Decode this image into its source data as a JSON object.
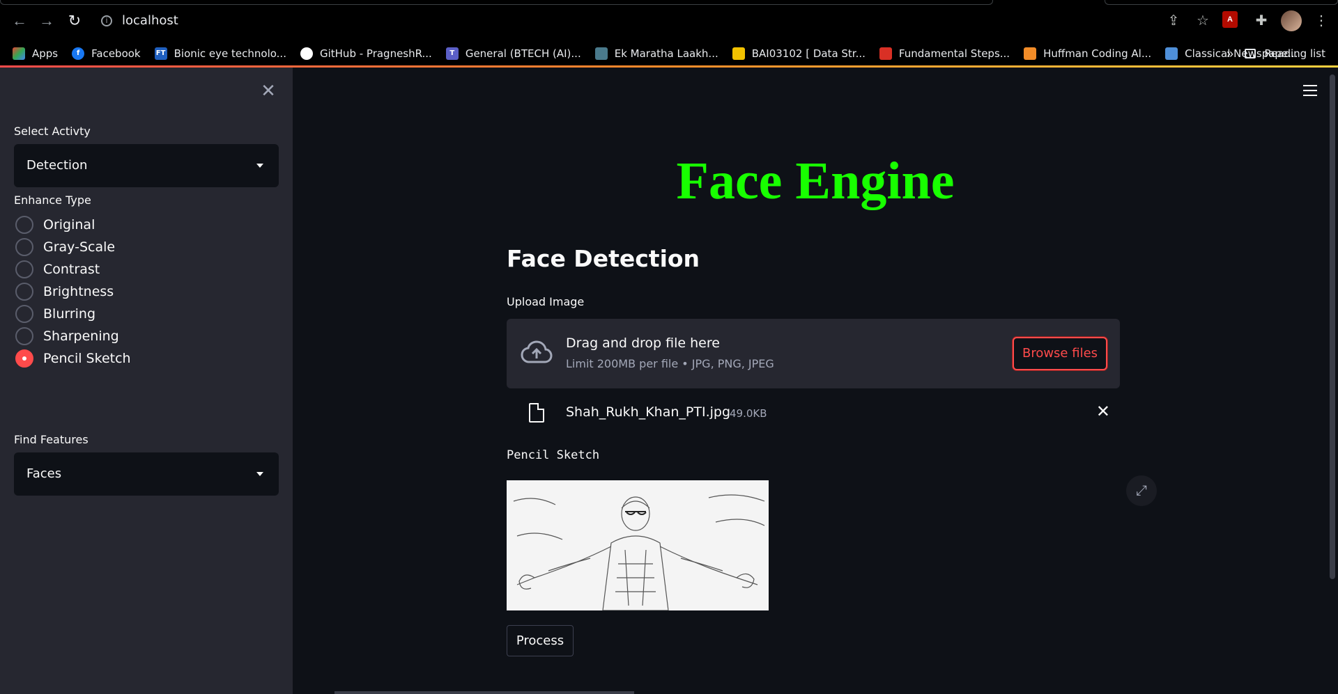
{
  "browser": {
    "url": "localhost",
    "bookmarks": [
      {
        "label": "Apps",
        "color": "#ea4335"
      },
      {
        "label": "Facebook",
        "color": "#1877f2"
      },
      {
        "label": "Bionic eye technolo...",
        "color": "#1f5fbf"
      },
      {
        "label": "GitHub - PragneshR...",
        "color": "#ffffff"
      },
      {
        "label": "General (BTECH (AI)...",
        "color": "#5b5fc7"
      },
      {
        "label": "Ek Maratha Laakh...",
        "color": "#4a7a8c"
      },
      {
        "label": "BAI03102 [ Data Str...",
        "color": "#f2c200"
      },
      {
        "label": "Fundamental Steps...",
        "color": "#d93025"
      },
      {
        "label": "Huffman Coding Al...",
        "color": "#f28c28"
      },
      {
        "label": "Classical Newspape...",
        "color": "#4f8fd8"
      }
    ],
    "more": "»",
    "reading_list": "Reading list"
  },
  "sidebar": {
    "select_label": "Select Activty",
    "select_value": "Detection",
    "enhance_label": "Enhance Type",
    "enhance_options": [
      "Original",
      "Gray-Scale",
      "Contrast",
      "Brightness",
      "Blurring",
      "Sharpening",
      "Pencil Sketch"
    ],
    "enhance_selected": "Pencil Sketch",
    "features_label": "Find Features",
    "features_value": "Faces"
  },
  "main": {
    "title": "Face Engine",
    "title_color": "#18ff00",
    "heading": "Face Detection",
    "upload_label": "Upload Image",
    "dropzone_main": "Drag and drop file here",
    "dropzone_sub": "Limit 200MB per file • JPG, PNG, JPEG",
    "browse_button": "Browse files",
    "file_name": "Shah_Rukh_Khan_PTI.jpg",
    "file_size": "49.0KB",
    "caption": "Pencil Sketch",
    "process_button": "Process"
  },
  "theme": {
    "accent": "#ff4b4b",
    "sidebar_bg": "#262730",
    "main_bg": "#0e1117"
  }
}
